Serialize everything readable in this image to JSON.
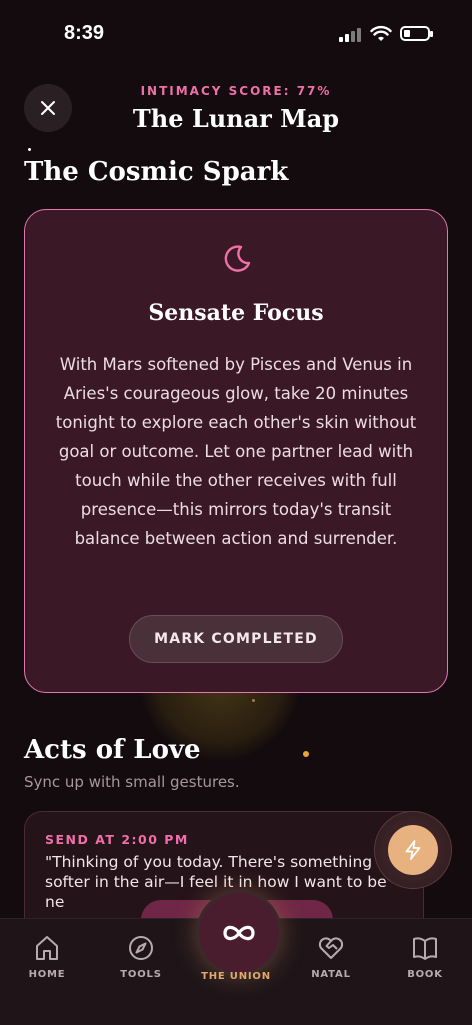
{
  "status_bar": {
    "time": "8:39"
  },
  "header": {
    "score": "INTIMACY SCORE: 77%",
    "title": "The Lunar Map"
  },
  "spark": {
    "section_title": "The Cosmic Spark",
    "card_title": "Sensate Focus",
    "card_body": "With Mars softened by Pisces and Venus in Aries's courageous glow, take 20 minutes tonight to explore each other's skin without goal or outcome. Let one partner lead with touch while the other receives with full presence—this mirrors today's transit balance between action and surrender.",
    "button_label": "MARK COMPLETED",
    "icon": "moon-icon"
  },
  "acts": {
    "section_title": "Acts of Love",
    "subtitle": "Sync up with small gestures.",
    "item": {
      "time": "SEND AT 2:00 PM",
      "text": "\"Thinking of you today. There's something softer in the air—I feel it in how I want to be ne"
    }
  },
  "tabs": [
    {
      "label": "HOME",
      "icon": "home-icon"
    },
    {
      "label": "TOOLS",
      "icon": "compass-icon"
    },
    {
      "label": "THE UNION",
      "icon": "infinity-icon"
    },
    {
      "label": "NATAL",
      "icon": "heart-handshake-icon"
    },
    {
      "label": "BOOK",
      "icon": "book-icon"
    }
  ],
  "colors": {
    "accent": "#ef6fa9",
    "card_bg": "#3a1826",
    "gold": "#e7b27f"
  }
}
